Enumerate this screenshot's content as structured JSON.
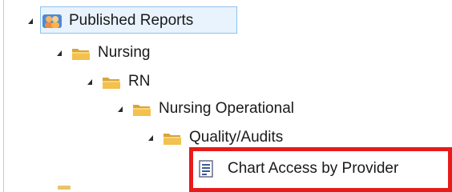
{
  "tree": {
    "items": [
      {
        "label": "Published Reports",
        "icon": "group-icon",
        "expanded": true,
        "level": 0
      },
      {
        "label": "Nursing",
        "icon": "folder-icon",
        "expanded": true,
        "level": 1
      },
      {
        "label": "RN",
        "icon": "folder-icon",
        "expanded": true,
        "level": 2
      },
      {
        "label": "Nursing Operational",
        "icon": "folder-icon",
        "expanded": true,
        "level": 3
      },
      {
        "label": "Quality/Audits",
        "icon": "folder-icon",
        "expanded": true,
        "level": 4
      },
      {
        "label": "Chart Access by Provider",
        "icon": "report-icon",
        "level": 5
      }
    ]
  },
  "colors": {
    "selection_border": "#8fc1ef",
    "selection_fill": "#e9f3fd",
    "highlight_border": "#e81a1a",
    "folder": "#f2c14e"
  }
}
